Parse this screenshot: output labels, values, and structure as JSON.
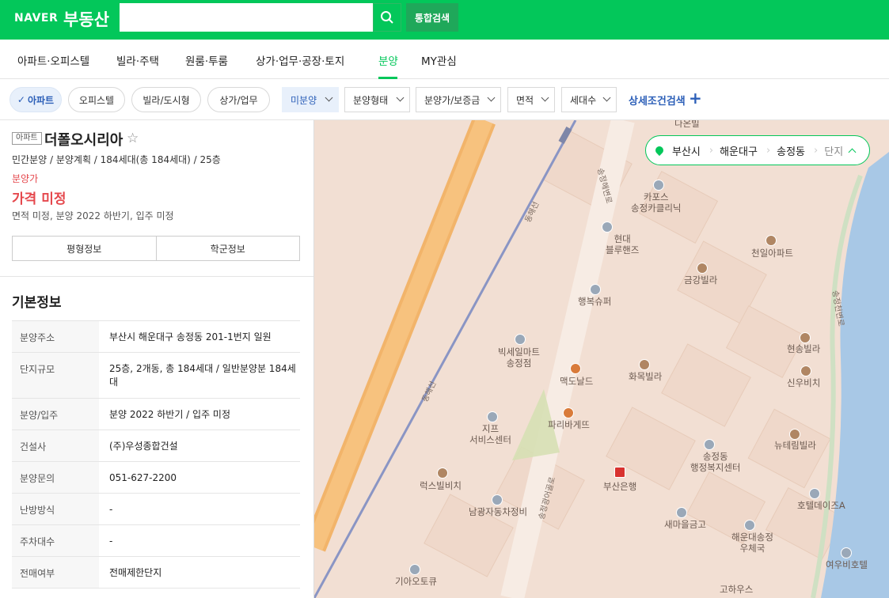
{
  "header": {
    "logo": "NAVER",
    "service": "부동산",
    "search_placeholder": "",
    "search_value": "",
    "unified_search": "통합검색"
  },
  "nav": {
    "tabs": [
      "아파트·오피스텔",
      "빌라·주택",
      "원룸·투룸",
      "상가·업무·공장·토지",
      "분양",
      "MY관심"
    ],
    "active": "분양"
  },
  "filters": {
    "chips": [
      "아파트",
      "오피스텔",
      "빌라/도시형",
      "상가/업무"
    ],
    "dropdowns": [
      "미분양",
      "분양형태",
      "분양가/보증금",
      "면적",
      "세대수"
    ],
    "detail_search": "상세조건검색"
  },
  "complex": {
    "type_badge": "아파트",
    "name": "더폴오시리아",
    "summary": "민간분양 / 분양계획 / 184세대(총 184세대) / 25층",
    "price_label": "분양가",
    "price_value": "가격 미정",
    "schedule": "면적 미정, 분양 2022 하반기, 입주 미정",
    "buttons": [
      "평형정보",
      "학군정보"
    ]
  },
  "basic_info": {
    "title": "기본정보",
    "rows": [
      {
        "key": "분양주소",
        "value": "부산시 해운대구 송정동 201-1번지 일원"
      },
      {
        "key": "단지규모",
        "value": "25층, 2개동, 총 184세대 / 일반분양분 184세대"
      },
      {
        "key": "분양/입주",
        "value": "분양 2022 하반기 / 입주 미정"
      },
      {
        "key": "건설사",
        "value": "(주)우성종합건설"
      },
      {
        "key": "분양문의",
        "value": "051-627-2200"
      },
      {
        "key": "난방방식",
        "value": "-"
      },
      {
        "key": "주차대수",
        "value": "-"
      },
      {
        "key": "전매여부",
        "value": "전매제한단지"
      }
    ]
  },
  "map": {
    "breadcrumb": [
      "부산시",
      "해운대구",
      "송정동",
      "단지"
    ],
    "labels": {
      "danuel": "다온빌",
      "capos": "카포스\n송정카클리닉",
      "hyundai": "현대\n블루핸즈",
      "chunil": "천일아파트",
      "geumgang": "금강빌라",
      "haengbok": "행복슈퍼",
      "bixel": "빅세일마트\n송정점",
      "mcd": "맥도날드",
      "hwamok": "화목빌라",
      "hyunsong": "현송빌라",
      "shinwoo": "신우비치",
      "jeep": "지프\n서비스센터",
      "paris": "파리바게뜨",
      "newteri": "뉴테림빌라",
      "songjeong_welfare": "송정동\n행정복지센터",
      "lux": "럭스빌비치",
      "busanbank": "부산은행",
      "namgwang": "남광자동차정비",
      "hotelA": "호텔데이즈A",
      "saemaeul": "새마을금고",
      "post": "해운대송정\n우체국",
      "kia": "기아오토큐",
      "hahouse": "고하우스",
      "yeou": "여우비호텔",
      "songjeong_station_road": "송정광어골로",
      "songjeong_river": "송정천변로",
      "line": "동해선",
      "road": "송정해변로"
    }
  }
}
